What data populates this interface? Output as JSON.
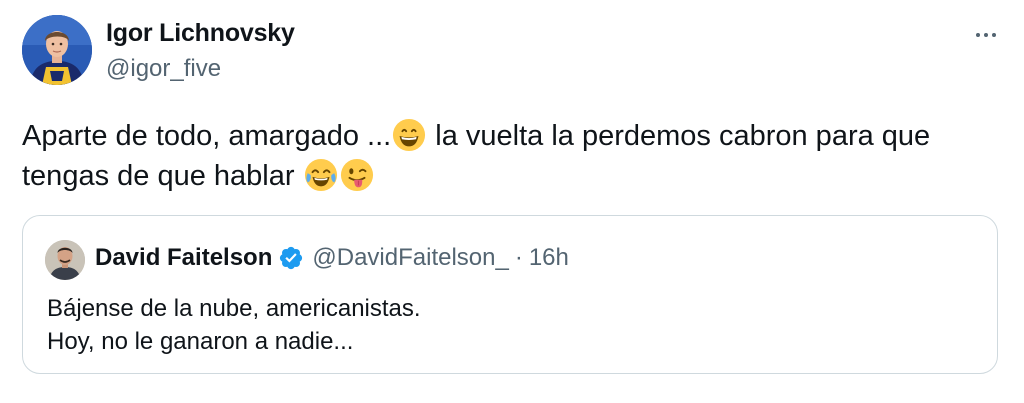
{
  "tweet": {
    "author_name": "Igor Lichnovsky",
    "author_handle": "@igor_five",
    "avatar_icon": "profile-photo-player-icon",
    "more_icon": "more-options-icon",
    "text_line1_a": "Aparte de todo, amargado ...",
    "text_line1_b": " la vuelta la perdemos cabron para que",
    "text_line2": "tengas de que hablar ",
    "emojis": [
      "grinning-face-emoji",
      "tears-of-joy-emoji",
      "winking-tongue-emoji"
    ]
  },
  "quoted_tweet": {
    "author_name": "David Faitelson",
    "verified_icon": "verified-badge-icon",
    "verified_color": "#1d9bf0",
    "author_handle": "@DavidFaitelson_",
    "separator": "·",
    "time": "16h",
    "text_line1": "Bájense de la nube, americanistas.",
    "text_line2": "Hoy, no le ganaron a nadie..."
  }
}
